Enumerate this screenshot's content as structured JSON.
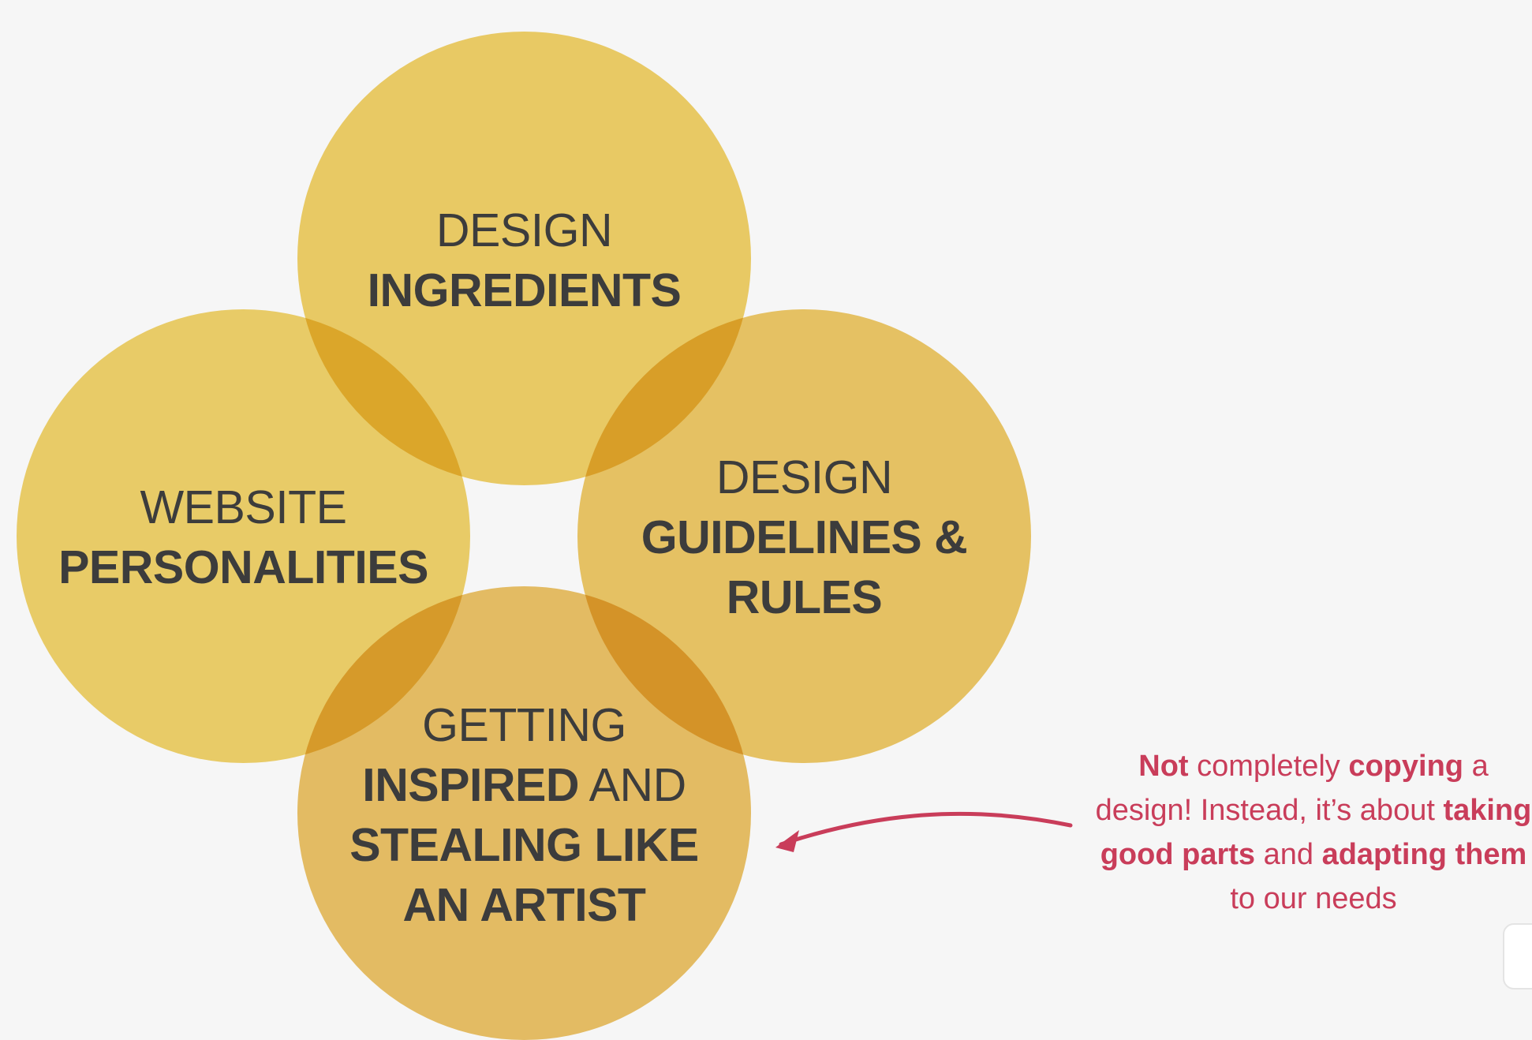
{
  "circles": {
    "top": {
      "line1": "DESIGN",
      "line2": "INGREDIENTS"
    },
    "left": {
      "line1": "WEBSITE",
      "line2": "PERSONALITIES"
    },
    "right": {
      "line1": "DESIGN",
      "line2": "GUIDELINES &",
      "line3": "RULES"
    },
    "bottom": {
      "line1": "GETTING",
      "line2_bold": "INSPIRED",
      "line2_light": " AND",
      "line3": "STEALING LIKE",
      "line4": "AN ARTIST"
    }
  },
  "annotation": {
    "p1": "Not",
    "p2": " completely ",
    "p3": "copying",
    "p4": " a design! Instead, it’s about ",
    "p5": "taking good parts",
    "p6": " and ",
    "p7": "adapting them",
    "p8": " to our needs"
  },
  "colors": {
    "background": "#f6f6f6",
    "circle_yellow": "#f1d168",
    "circle_orange": "#ecc266",
    "text_dark": "#3c3c3c",
    "accent_red": "#c93d5a"
  }
}
